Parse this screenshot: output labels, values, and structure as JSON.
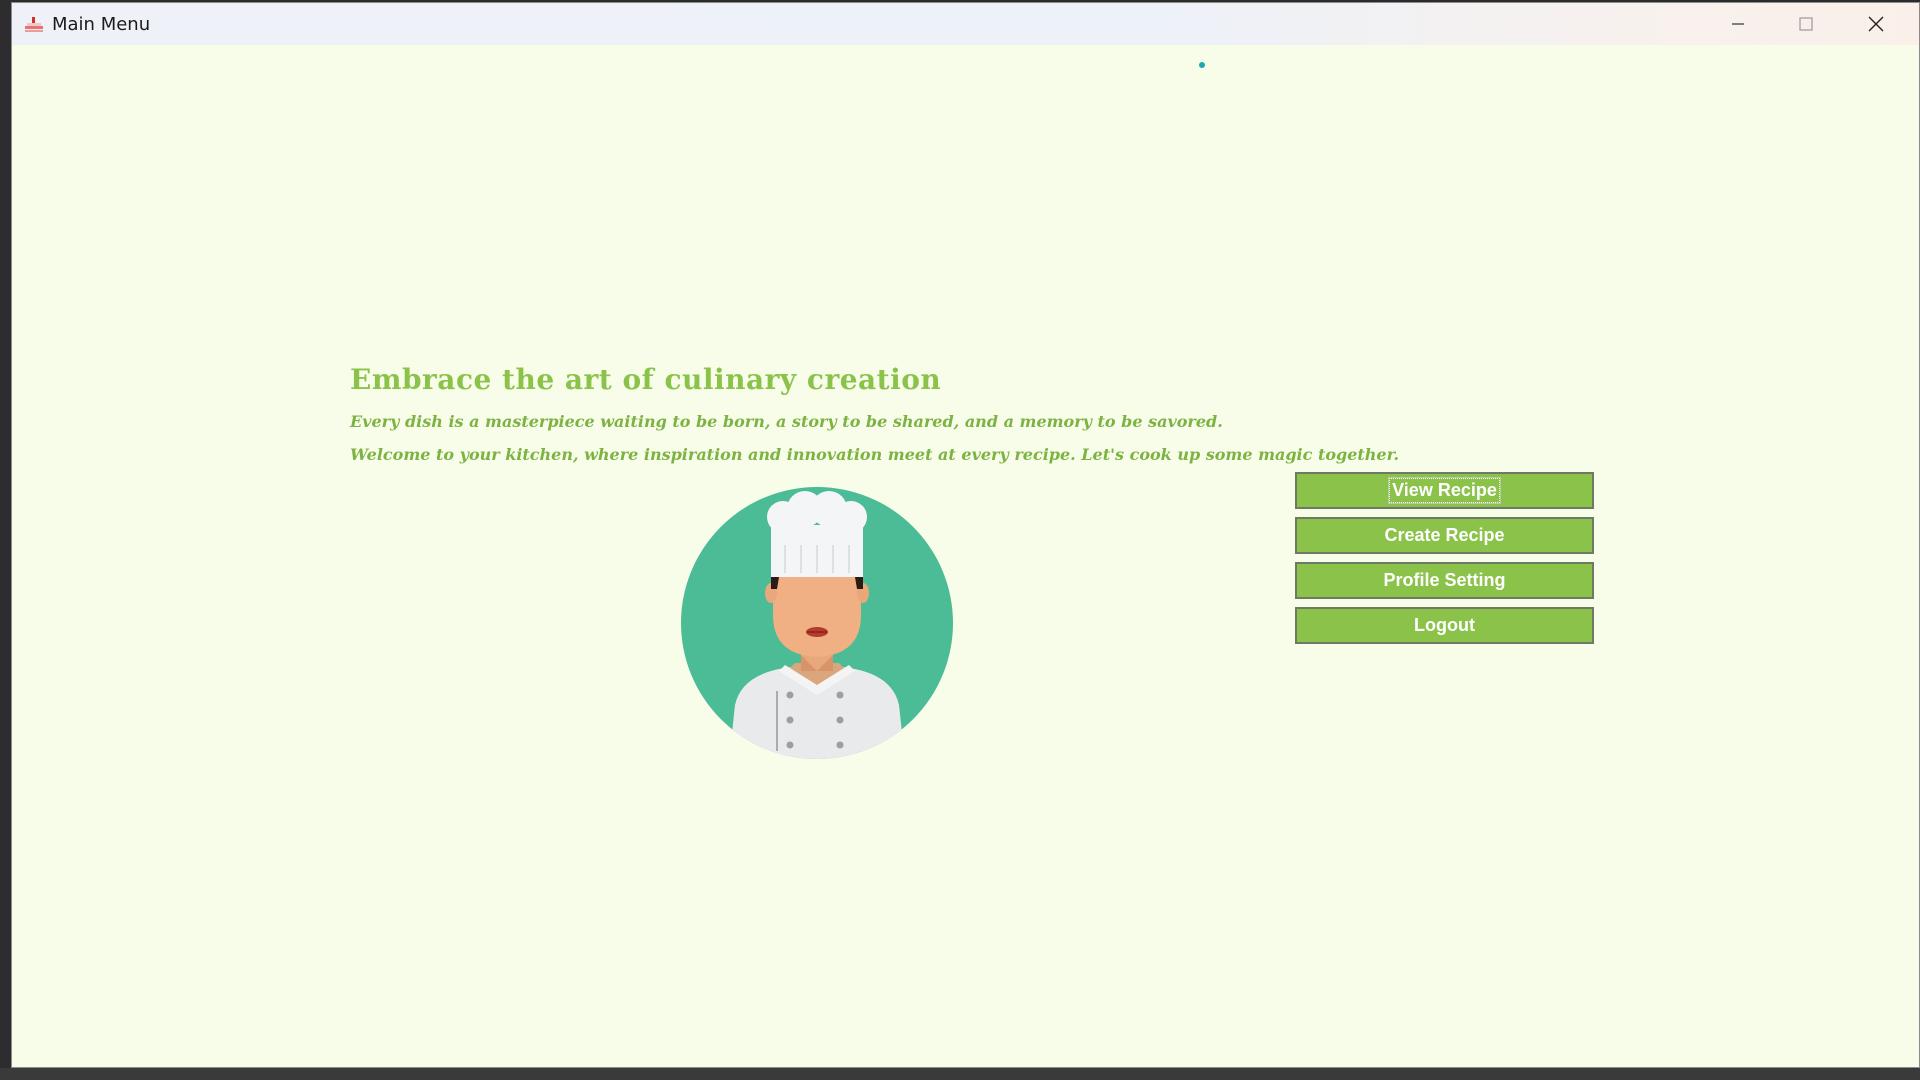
{
  "window": {
    "title": "Main Menu",
    "controls": {
      "minimize_icon": "minimize-icon",
      "maximize_icon": "maximize-icon",
      "close_icon": "close-icon"
    }
  },
  "hero": {
    "headline": "Embrace the art of culinary creation",
    "tagline_1": "Every dish is a masterpiece waiting to be born, a story to be shared, and a memory to be savored.",
    "tagline_2": "Welcome to your kitchen, where inspiration and innovation meet at every recipe. Let's cook up some magic together."
  },
  "menu": {
    "view_recipe": "View Recipe",
    "create_recipe": "Create Recipe",
    "profile_setting": "Profile Setting",
    "logout": "Logout"
  },
  "colors": {
    "background": "#f8fdea",
    "accent_green": "#8bc34a",
    "avatar_teal": "#4cbc96"
  }
}
